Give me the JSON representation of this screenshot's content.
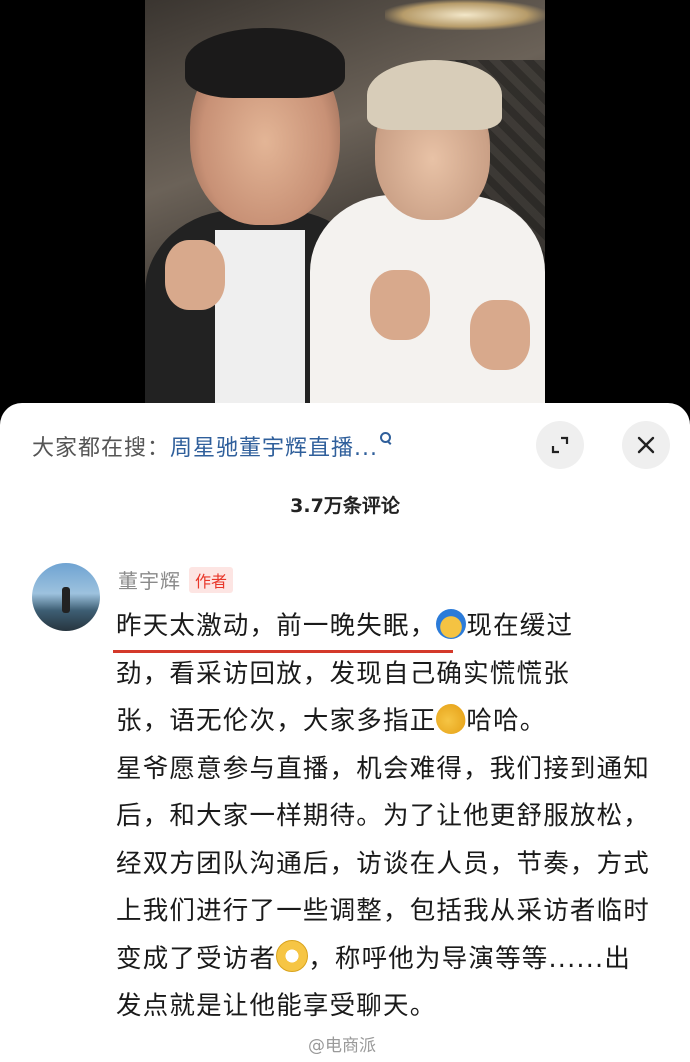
{
  "search": {
    "prefix": "大家都在搜：",
    "query": "周星驰董宇辉直播..."
  },
  "header": {
    "comment_count": "3.7万条评论"
  },
  "comment": {
    "author": "董宇辉",
    "author_tag": "作者",
    "line1_a": "昨天太激动，前一晚失眠，",
    "line1_b": "现在缓过",
    "line2": "劲，看采访回放，发现自己确实慌慌张",
    "line3_a": "张，语无伦次，大家多指正",
    "line3_b": "哈哈。",
    "para2_a": "星爷愿意参与直播，机会难得，我们接到通知后，和大家一样期待。为了让他更舒服放松，经双方团队沟通后，访谈在人员，节奏，方式上我们进行了一些调整，包括我从采访者临时变成了受访者",
    "para2_b": "，称呼他为导演等等......出发点就是让他能享受聊天。"
  },
  "watermark": "@电商派",
  "icons": [
    "search-icon",
    "expand-icon",
    "close-icon",
    "emoji-hot",
    "emoji-muscle",
    "emoji-grin"
  ]
}
